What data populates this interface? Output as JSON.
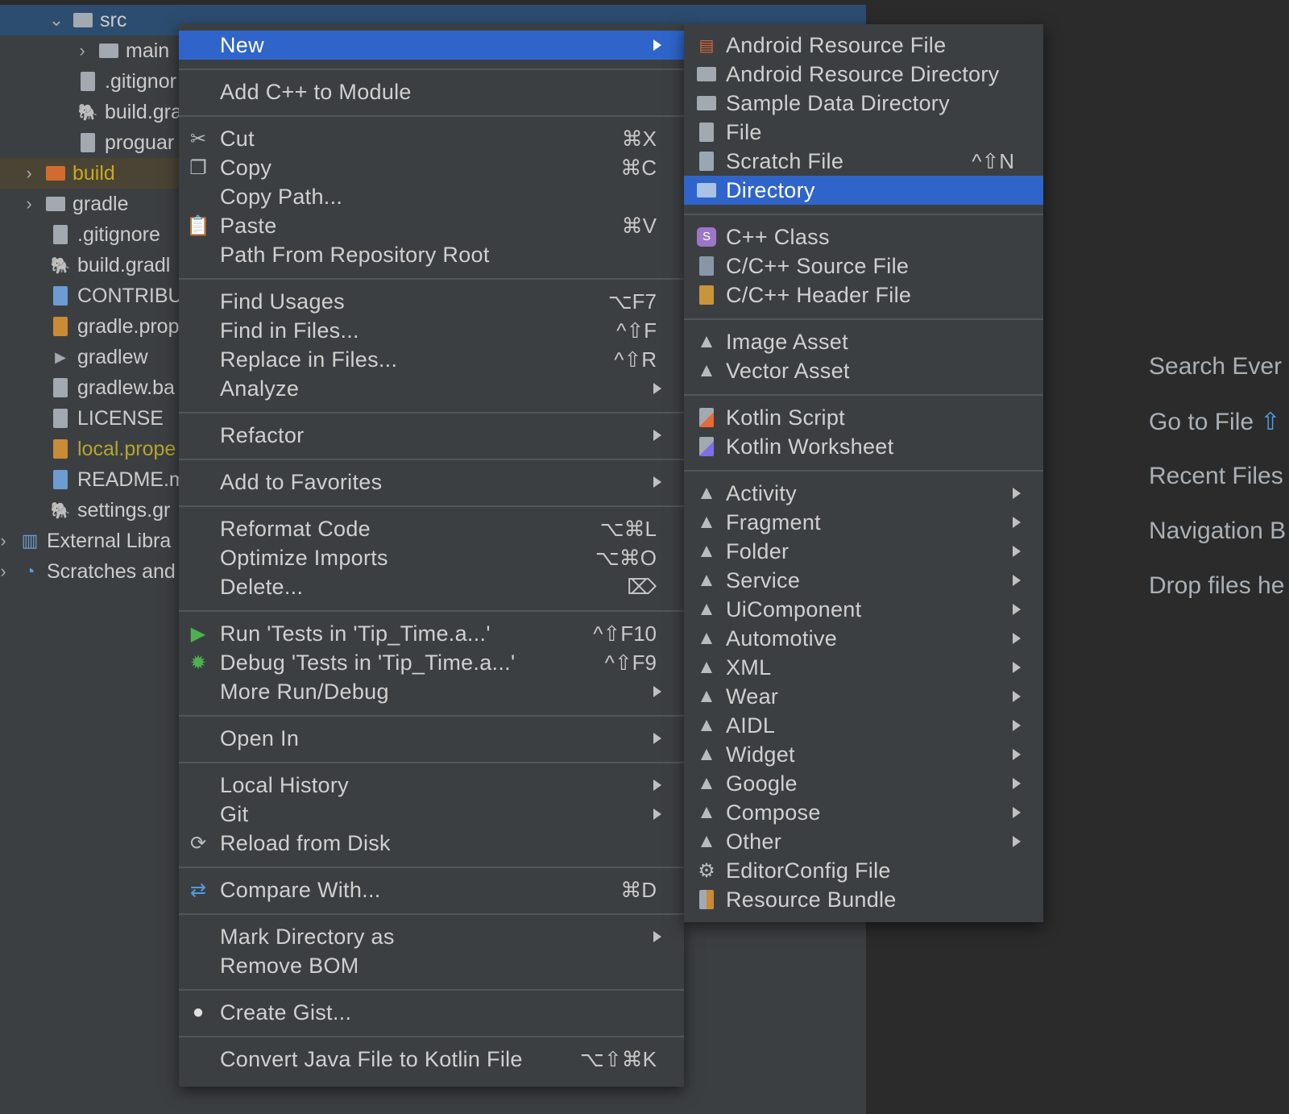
{
  "tree": {
    "items": [
      {
        "label": "src",
        "chevron": "down",
        "icon": "folder-icon"
      },
      {
        "label": "main",
        "chevron": "right",
        "icon": "folder-icon"
      },
      {
        "label": ".gitignor",
        "icon": "gitignore-file-icon"
      },
      {
        "label": "build.gra",
        "icon": "gradle-file-icon"
      },
      {
        "label": "proguar",
        "icon": "text-file-icon"
      },
      {
        "label": "build",
        "chevron": "right",
        "icon": "excluded-folder-icon"
      },
      {
        "label": "gradle",
        "chevron": "right",
        "icon": "folder-icon"
      },
      {
        "label": ".gitignore",
        "icon": "gitignore-file-icon"
      },
      {
        "label": "build.gradl",
        "icon": "gradle-file-icon"
      },
      {
        "label": "CONTRIBU",
        "icon": "markdown-file-icon"
      },
      {
        "label": "gradle.prop",
        "icon": "properties-file-icon"
      },
      {
        "label": "gradlew",
        "icon": "shell-file-icon"
      },
      {
        "label": "gradlew.ba",
        "icon": "text-file-icon"
      },
      {
        "label": "LICENSE",
        "icon": "text-file-icon"
      },
      {
        "label": "local.prope",
        "icon": "properties-file-icon"
      },
      {
        "label": "README.m",
        "icon": "markdown-file-icon"
      },
      {
        "label": "settings.gr",
        "icon": "gradle-file-icon"
      },
      {
        "label": "External Libra",
        "chevron": "right",
        "icon": "libraries-icon"
      },
      {
        "label": "Scratches and",
        "chevron": "right",
        "icon": "scratches-icon"
      }
    ]
  },
  "welcome": {
    "hints": [
      {
        "label": "Search Ever"
      },
      {
        "label": "Go to File",
        "key": "⇧"
      },
      {
        "label": "Recent Files"
      },
      {
        "label": "Navigation B"
      },
      {
        "label": "Drop files he"
      }
    ]
  },
  "menu": {
    "items": [
      {
        "label": "New",
        "submenu": true,
        "selected": true
      },
      {
        "label": "Add C++ to Module"
      },
      {
        "label": "Cut",
        "shortcut": "⌘X",
        "icon": "scissors-icon"
      },
      {
        "label": "Copy",
        "shortcut": "⌘C",
        "icon": "copy-icon"
      },
      {
        "label": "Copy Path..."
      },
      {
        "label": "Paste",
        "shortcut": "⌘V",
        "icon": "clipboard-icon"
      },
      {
        "label": "Path From Repository Root"
      },
      {
        "label": "Find Usages",
        "shortcut": "⌥F7"
      },
      {
        "label": "Find in Files...",
        "shortcut": "^⇧F"
      },
      {
        "label": "Replace in Files...",
        "shortcut": "^⇧R"
      },
      {
        "label": "Analyze",
        "submenu": true
      },
      {
        "label": "Refactor",
        "submenu": true
      },
      {
        "label": "Add to Favorites",
        "submenu": true
      },
      {
        "label": "Reformat Code",
        "shortcut": "⌥⌘L"
      },
      {
        "label": "Optimize Imports",
        "shortcut": "⌥⌘O"
      },
      {
        "label": "Delete...",
        "shortcut": "⌦"
      },
      {
        "label": "Run 'Tests in 'Tip_Time.a...'",
        "shortcut": "^⇧F10",
        "icon": "run-icon"
      },
      {
        "label": "Debug 'Tests in 'Tip_Time.a...'",
        "shortcut": "^⇧F9",
        "icon": "debug-icon"
      },
      {
        "label": "More Run/Debug",
        "submenu": true
      },
      {
        "label": "Open In",
        "submenu": true
      },
      {
        "label": "Local History",
        "submenu": true
      },
      {
        "label": "Git",
        "submenu": true
      },
      {
        "label": "Reload from Disk",
        "icon": "reload-icon"
      },
      {
        "label": "Compare With...",
        "shortcut": "⌘D",
        "icon": "compare-icon"
      },
      {
        "label": "Mark Directory as",
        "submenu": true
      },
      {
        "label": "Remove BOM"
      },
      {
        "label": "Create Gist...",
        "icon": "github-icon"
      },
      {
        "label": "Convert Java File to Kotlin File",
        "shortcut": "⌥⇧⌘K"
      }
    ]
  },
  "submenu": {
    "items": [
      {
        "label": "Android Resource File",
        "icon": "android-resource-file-icon"
      },
      {
        "label": "Android Resource Directory",
        "icon": "folder-icon"
      },
      {
        "label": "Sample Data Directory",
        "icon": "folder-icon"
      },
      {
        "label": "File",
        "icon": "file-icon"
      },
      {
        "label": "Scratch File",
        "shortcut": "^⇧N",
        "icon": "scratch-file-icon"
      },
      {
        "label": "Directory",
        "selected": true,
        "icon": "folder-icon"
      },
      {
        "label": "C++ Class",
        "icon": "cpp-class-icon"
      },
      {
        "label": "C/C++ Source File",
        "icon": "cpp-source-icon"
      },
      {
        "label": "C/C++ Header File",
        "icon": "cpp-header-icon"
      },
      {
        "label": "Image Asset",
        "icon": "android-icon"
      },
      {
        "label": "Vector Asset",
        "icon": "android-icon"
      },
      {
        "label": "Kotlin Script",
        "icon": "kotlin-script-icon"
      },
      {
        "label": "Kotlin Worksheet",
        "icon": "kotlin-worksheet-icon"
      },
      {
        "label": "Activity",
        "submenu": true,
        "icon": "android-icon"
      },
      {
        "label": "Fragment",
        "submenu": true,
        "icon": "android-icon"
      },
      {
        "label": "Folder",
        "submenu": true,
        "icon": "android-icon"
      },
      {
        "label": "Service",
        "submenu": true,
        "icon": "android-icon"
      },
      {
        "label": "UiComponent",
        "submenu": true,
        "icon": "android-icon"
      },
      {
        "label": "Automotive",
        "submenu": true,
        "icon": "android-icon"
      },
      {
        "label": "XML",
        "submenu": true,
        "icon": "android-icon"
      },
      {
        "label": "Wear",
        "submenu": true,
        "icon": "android-icon"
      },
      {
        "label": "AIDL",
        "submenu": true,
        "icon": "android-icon"
      },
      {
        "label": "Widget",
        "submenu": true,
        "icon": "android-icon"
      },
      {
        "label": "Google",
        "submenu": true,
        "icon": "android-icon"
      },
      {
        "label": "Compose",
        "submenu": true,
        "icon": "android-icon"
      },
      {
        "label": "Other",
        "submenu": true,
        "icon": "android-icon"
      },
      {
        "label": "EditorConfig File",
        "icon": "gear-icon"
      },
      {
        "label": "Resource Bundle",
        "icon": "resource-bundle-icon"
      }
    ]
  },
  "colors": {
    "selection": "#2f65ca",
    "menu_bg": "#3c3f41",
    "android_green": "#3ddc84"
  }
}
